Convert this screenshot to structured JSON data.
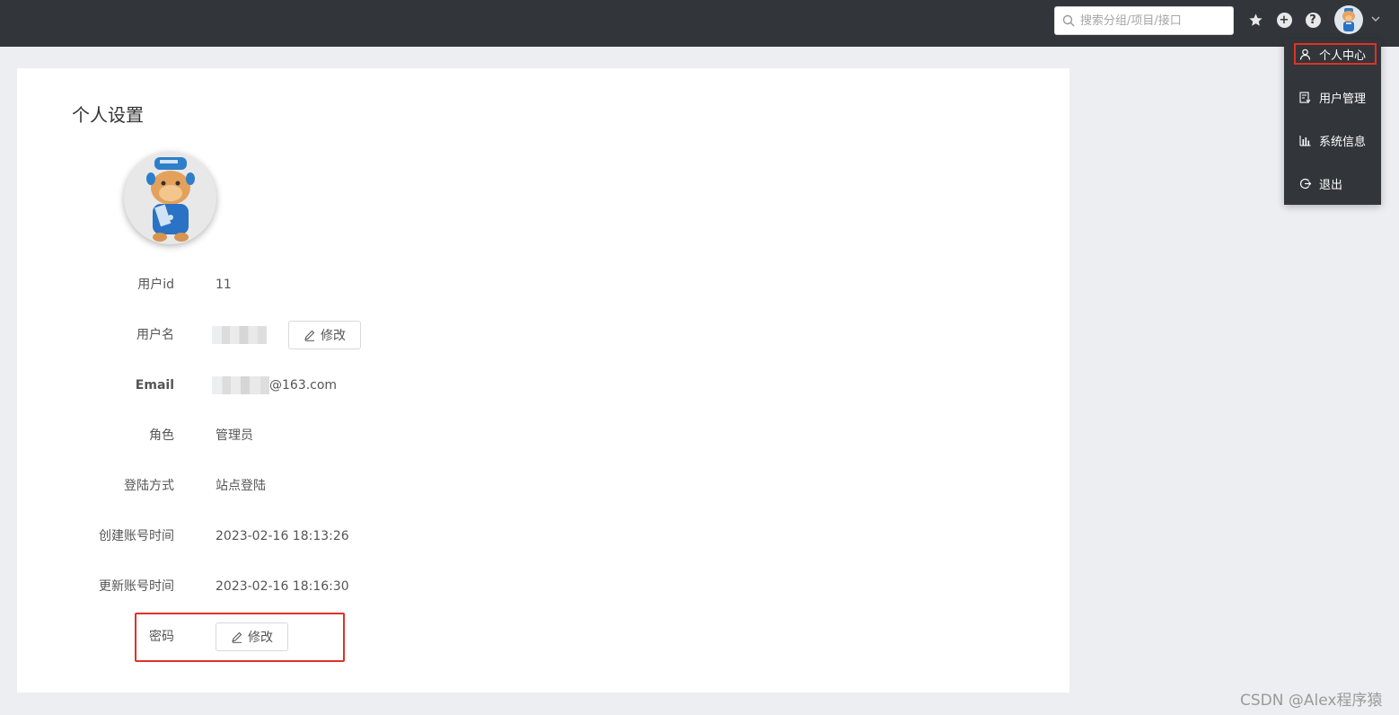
{
  "header": {
    "search_placeholder": "搜索分组/项目/接口"
  },
  "header_icons": [
    "star-icon",
    "plus-circle-icon",
    "help-circle-icon",
    "avatar",
    "chevron-down-icon"
  ],
  "dropdown_menu": {
    "items": [
      {
        "label": "个人中心",
        "icon": "user-icon"
      },
      {
        "label": "用户管理",
        "icon": "user-manage-icon"
      },
      {
        "label": "系统信息",
        "icon": "bar-chart-icon"
      },
      {
        "label": "退出",
        "icon": "logout-icon"
      }
    ]
  },
  "profile": {
    "title": "个人设置",
    "fields": {
      "user_id": {
        "label": "用户id",
        "value": "11"
      },
      "username": {
        "label": "用户名"
      },
      "email": {
        "label": "Email",
        "value_suffix": "@163.com"
      },
      "role": {
        "label": "角色",
        "value": "管理员"
      },
      "login_method": {
        "label": "登陆方式",
        "value": "站点登陆"
      },
      "created": {
        "label": "创建账号时间",
        "value": "2023-02-16 18:13:26"
      },
      "updated": {
        "label": "更新账号时间",
        "value": "2023-02-16 18:16:30"
      },
      "password": {
        "label": "密码"
      }
    },
    "edit_label": "修改"
  },
  "watermark": "CSDN @Alex程序猿",
  "colors": {
    "topbar": "#32363a",
    "highlight": "#e23028",
    "page_bg": "#eceef1"
  }
}
